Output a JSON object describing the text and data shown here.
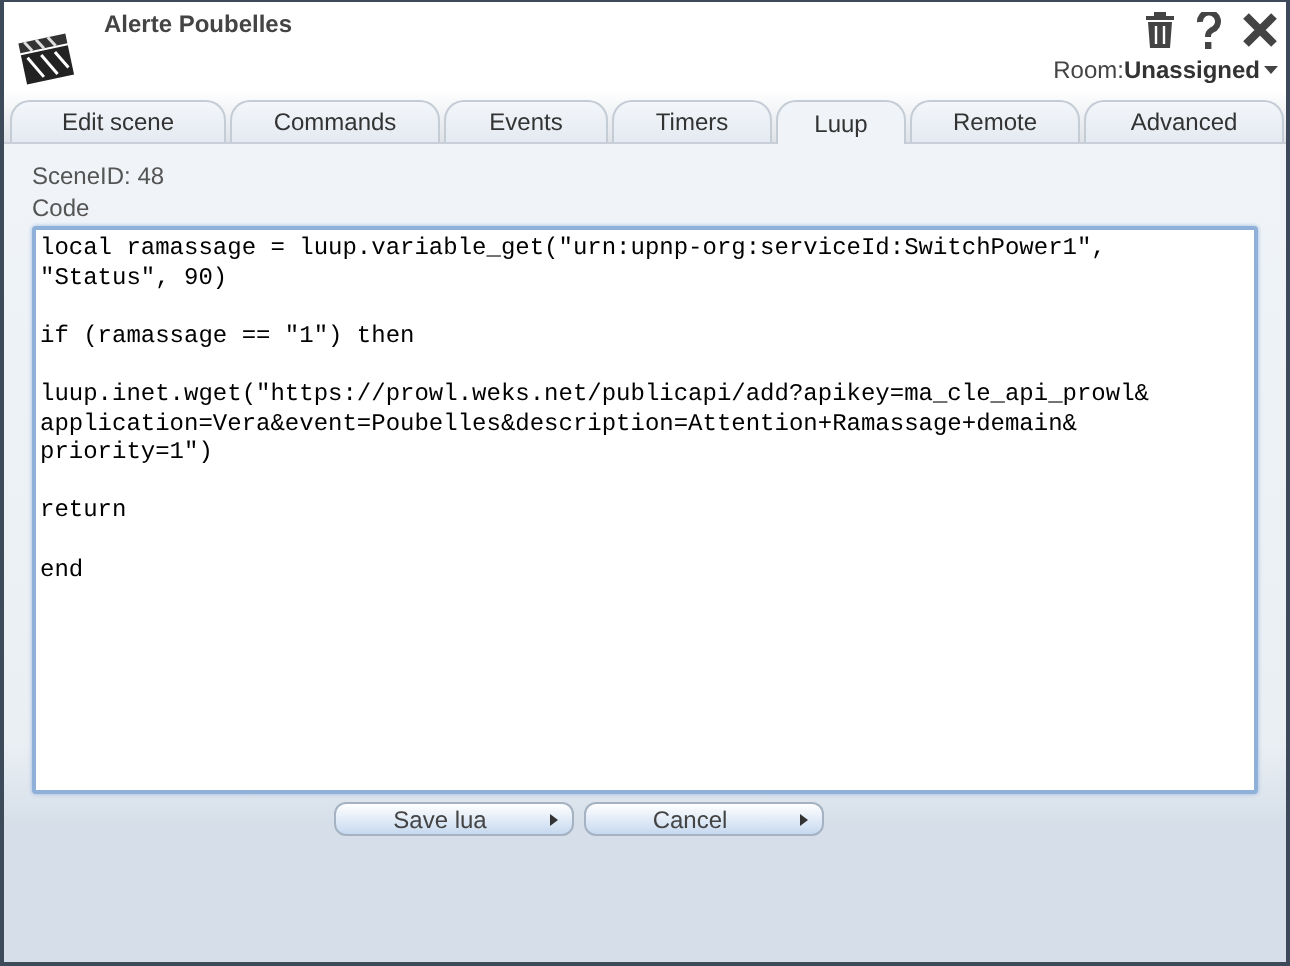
{
  "window": {
    "title": "Alerte Poubelles",
    "room_label": "Room:",
    "room_value": "Unassigned"
  },
  "tabs": [
    {
      "label": "Edit scene",
      "selected": false
    },
    {
      "label": "Commands",
      "selected": false
    },
    {
      "label": "Events",
      "selected": false
    },
    {
      "label": "Timers",
      "selected": false
    },
    {
      "label": "Luup",
      "selected": true
    },
    {
      "label": "Remote",
      "selected": false
    },
    {
      "label": "Advanced",
      "selected": false
    }
  ],
  "scene_id": "SceneID: 48",
  "code": {
    "label": "Code",
    "text": "local ramassage = luup.variable_get(\"urn:upnp-org:serviceId:SwitchPower1\",\n\"Status\", 90)\n\nif (ramassage == \"1\") then\n\nluup.inet.wget(\"https://prowl.weks.net/publicapi/add?apikey=ma_cle_api_prowl&\napplication=Vera&event=Poubelles&description=Attention+Ramassage+demain&\npriority=1\")\n\nreturn\n\nend"
  },
  "buttons": [
    "Save lua",
    "Cancel"
  ]
}
